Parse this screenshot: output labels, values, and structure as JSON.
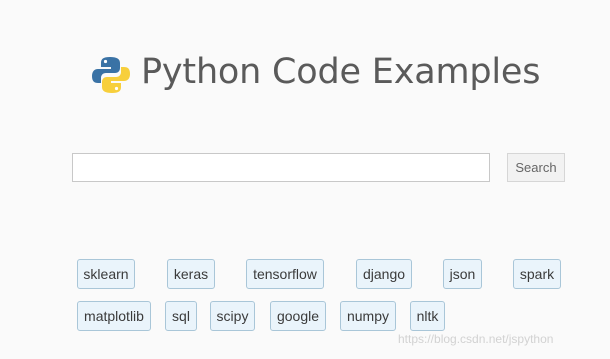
{
  "header": {
    "logo_icon": "python-logo-icon",
    "title": "Python Code Examples"
  },
  "search": {
    "value": "",
    "placeholder": "",
    "button_label": "Search"
  },
  "tags": [
    "sklearn",
    "keras",
    "tensorflow",
    "django",
    "json",
    "spark",
    "matplotlib",
    "sql",
    "scipy",
    "google",
    "numpy",
    "nltk"
  ],
  "watermark": "https://blog.csdn.net/jspython",
  "colors": {
    "background": "#fafafa",
    "title": "#5a5a5a",
    "tag_background": "#eaf4fb",
    "tag_border": "#a9c6d8",
    "python_blue": "#3a72a5",
    "python_yellow": "#f7cf3c"
  }
}
